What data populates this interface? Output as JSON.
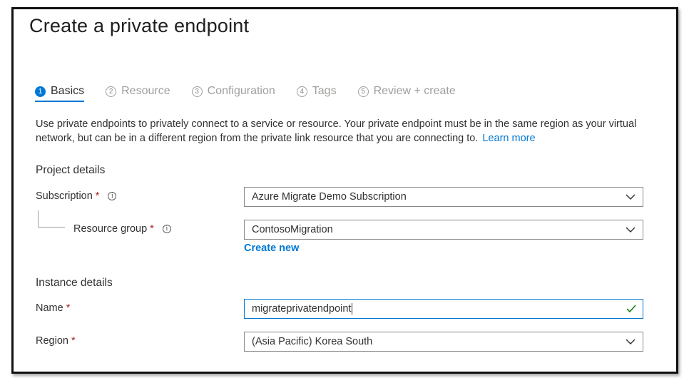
{
  "page": {
    "title": "Create a private endpoint"
  },
  "tabs": [
    {
      "num": "1",
      "label": "Basics",
      "active": true
    },
    {
      "num": "2",
      "label": "Resource",
      "active": false
    },
    {
      "num": "3",
      "label": "Configuration",
      "active": false
    },
    {
      "num": "4",
      "label": "Tags",
      "active": false
    },
    {
      "num": "5",
      "label": "Review + create",
      "active": false
    }
  ],
  "description": {
    "text": "Use private endpoints to privately connect to a service or resource. Your private endpoint must be in the same region as your virtual network, but can be in a different region from the private link resource that you are connecting to.",
    "link": "Learn more"
  },
  "project_details": {
    "heading": "Project details",
    "subscription": {
      "label": "Subscription",
      "required": "*",
      "value": "Azure Migrate Demo Subscription"
    },
    "resource_group": {
      "label": "Resource group",
      "required": "*",
      "value": "ContosoMigration",
      "create_new": "Create new"
    }
  },
  "instance_details": {
    "heading": "Instance details",
    "name": {
      "label": "Name",
      "required": "*",
      "value": "migrateprivatendpoint"
    },
    "region": {
      "label": "Region",
      "required": "*",
      "value": "(Asia Pacific) Korea South"
    }
  },
  "icons": {
    "info": "info-icon",
    "dropdown": "chevron-down-icon",
    "valid": "checkmark-icon"
  },
  "colors": {
    "accent": "#0078d4",
    "required": "#a4262c",
    "valid": "#107c10"
  }
}
